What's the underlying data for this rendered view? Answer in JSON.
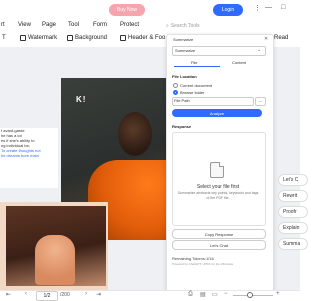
{
  "topbar": {
    "buy_now": "Buy Now",
    "login": "Login",
    "window_controls": [
      "⋮",
      "—",
      "□"
    ]
  },
  "menu": {
    "items": [
      "rt",
      "View",
      "Page",
      "Tool",
      "Form",
      "Protect"
    ],
    "search_placeholder": "Search Tools"
  },
  "toolbar": {
    "watermark": "Watermark",
    "background": "Background",
    "header_footer": "Header & Foo",
    "read": "Read"
  },
  "document": {
    "left_text": [
      "f avant-garde",
      "he has a lot",
      "es if she's ability to",
      "ng individual be-",
      "To create thoughts not",
      "he dreams bore main"
    ],
    "logo_mark": "K!"
  },
  "panel": {
    "title": "Summarize",
    "mode_select": "Summarize",
    "tabs": [
      "File",
      "Content"
    ],
    "file_location_label": "File Location",
    "radio_current": "Current document",
    "radio_browse": "Browse folder",
    "file_name": "File Path",
    "dots": "···",
    "analyze": "Analyze",
    "response_label": "Response",
    "select_file": "Select your file first",
    "description": "Summarize abstracts key points, keywords and tags of the PDF file.",
    "copy_response": "Copy Response",
    "lets_chat": "Let's Chat",
    "remaining_tokens": "Remaining Tokens:1/16",
    "powered_by": "Powered by ChatGPT, UPDF for the Windows"
  },
  "side_pills": [
    "Let's C",
    "Rewrit",
    "Proofr",
    "Explain",
    "Summa"
  ],
  "statusbar": {
    "page_current": "1/2",
    "page_total": "/200"
  },
  "colors": {
    "accent": "#2f6bff",
    "buy_now": "#f4a5ad"
  }
}
